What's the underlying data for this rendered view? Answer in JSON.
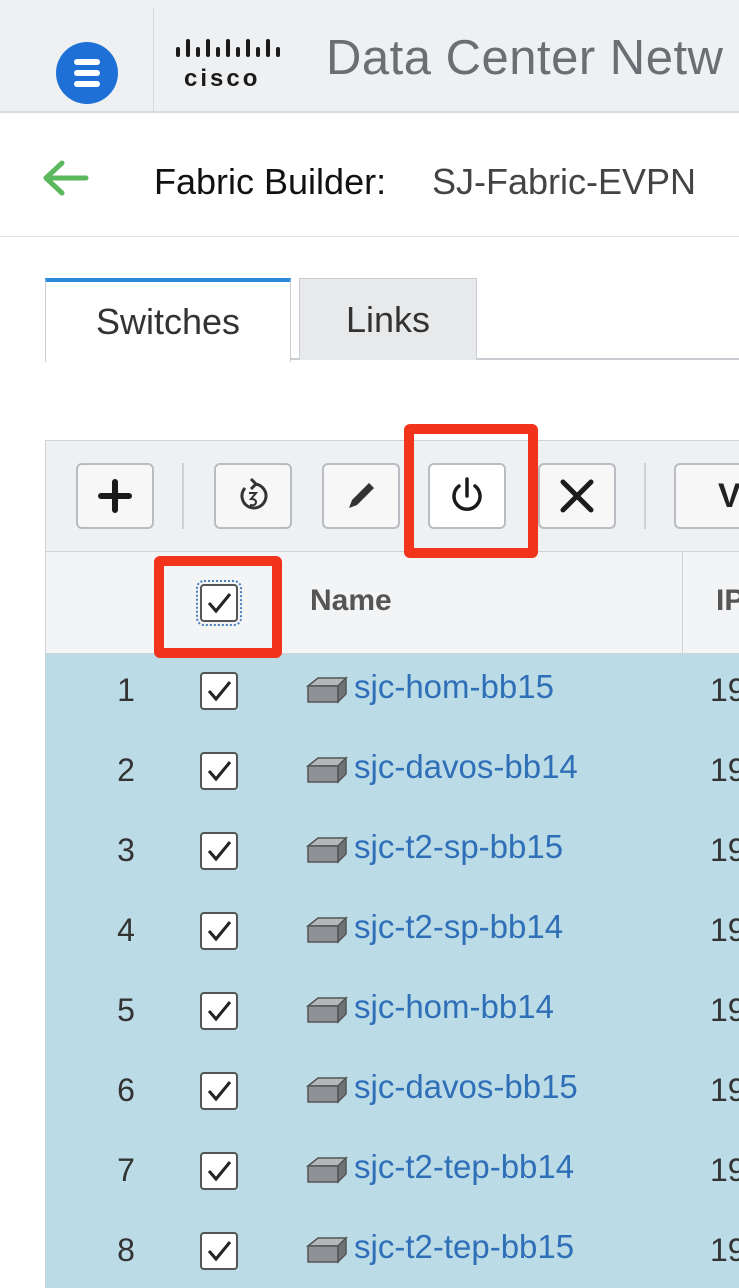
{
  "app": {
    "title": "Data Center Netw",
    "logo_text": "cisco"
  },
  "breadcrumb": {
    "label": "Fabric Builder:",
    "value": "SJ-Fabric-EVPN"
  },
  "tabs": [
    {
      "label": "Switches",
      "active": true
    },
    {
      "label": "Links",
      "active": false
    }
  ],
  "toolbar": {
    "buttons": [
      {
        "name": "add-icon"
      },
      {
        "name": "reload-icon"
      },
      {
        "name": "edit-icon"
      },
      {
        "name": "power-icon"
      },
      {
        "name": "delete-icon"
      }
    ],
    "view_label": "V"
  },
  "table": {
    "columns": {
      "name": "Name",
      "ip": "IP"
    },
    "header_checked": true,
    "rows": [
      {
        "num": "1",
        "name": "sjc-hom-bb15",
        "ip": "19",
        "checked": true
      },
      {
        "num": "2",
        "name": "sjc-davos-bb14",
        "ip": "19",
        "checked": true
      },
      {
        "num": "3",
        "name": "sjc-t2-sp-bb15",
        "ip": "19",
        "checked": true
      },
      {
        "num": "4",
        "name": "sjc-t2-sp-bb14",
        "ip": "19",
        "checked": true
      },
      {
        "num": "5",
        "name": "sjc-hom-bb14",
        "ip": "19",
        "checked": true
      },
      {
        "num": "6",
        "name": "sjc-davos-bb15",
        "ip": "19",
        "checked": true
      },
      {
        "num": "7",
        "name": "sjc-t2-tep-bb14",
        "ip": "19",
        "checked": true
      },
      {
        "num": "8",
        "name": "sjc-t2-tep-bb15",
        "ip": "19",
        "checked": true
      }
    ]
  },
  "colors": {
    "accent": "#1f70d6",
    "highlight": "#f2341c",
    "row_selected": "#bbdce6",
    "link": "#2f6fb7",
    "back_arrow": "#5cb85c"
  }
}
